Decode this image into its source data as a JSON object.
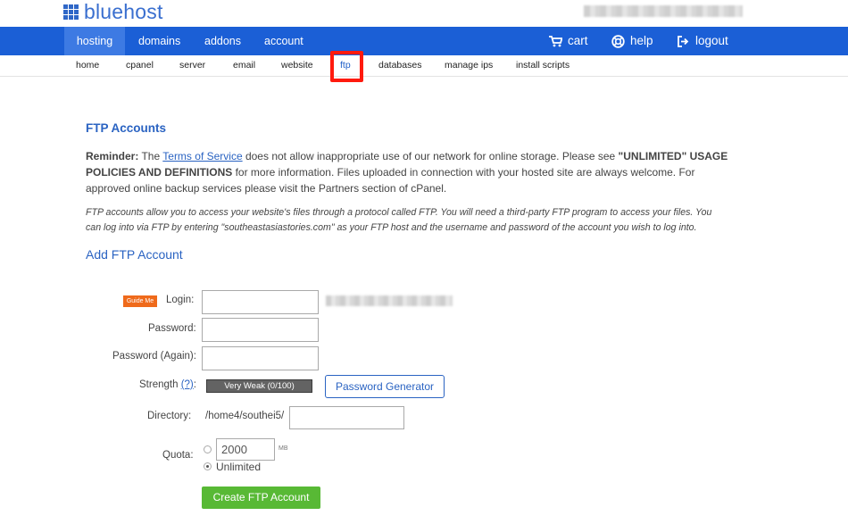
{
  "brand": {
    "name": "bluehost",
    "color": "#1b5fd6"
  },
  "nav": {
    "items": [
      "hosting",
      "domains",
      "addons",
      "account"
    ],
    "active": "hosting",
    "right": {
      "cart": "cart",
      "help": "help",
      "logout": "logout"
    }
  },
  "subnav": {
    "items": [
      "home",
      "cpanel",
      "server",
      "email",
      "website",
      "ftp",
      "databases",
      "manage ips",
      "install scripts"
    ],
    "active": "ftp"
  },
  "page": {
    "title": "FTP Accounts",
    "reminder_bold": "Reminder:",
    "reminder_pre": " The ",
    "tos_link": "Terms of Service",
    "reminder_mid": " does not allow inappropriate use of our network for online storage. Please see ",
    "reminder_policy": "\"UNLIMITED\" USAGE POLICIES AND DEFINITIONS",
    "reminder_post": " for more information. Files uploaded in connection with your hosted site are always welcome. For approved online backup services please visit the Partners section of cPanel.",
    "info": "FTP accounts allow you to access your website's files through a protocol called FTP. You will need a third-party FTP program to access your files. You can log into via FTP by entering \"southeastasiastories.com\" as your FTP host and the username and password of the account you wish to log into.",
    "add_title": "Add FTP Account"
  },
  "form": {
    "guide_me": "Guide Me",
    "login_label": "Login:",
    "password_label": "Password:",
    "password_again_label": "Password (Again):",
    "strength_label": "Strength",
    "strength_help": "(?)",
    "strength_colon": ":",
    "strength_value": "Very Weak (0/100)",
    "password_generator": "Password Generator",
    "directory_label": "Directory:",
    "directory_prefix": "/home4/southei5/",
    "quota_label": "Quota:",
    "quota_value": "2000",
    "quota_unit": "MB",
    "unlimited_label": "Unlimited",
    "submit": "Create FTP Account"
  }
}
